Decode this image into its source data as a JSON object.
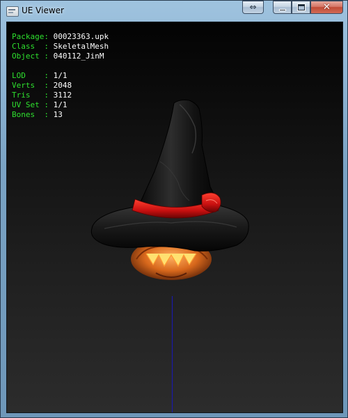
{
  "window": {
    "title": "UE Viewer"
  },
  "info": {
    "package": {
      "label": "Package: ",
      "value": "00023363.upk"
    },
    "class": {
      "label": "Class  : ",
      "value": "SkeletalMesh"
    },
    "object": {
      "label": "Object : ",
      "value": "040112_JinM"
    },
    "lod": {
      "label": "LOD    : ",
      "value": "1/1"
    },
    "verts": {
      "label": "Verts  : ",
      "value": "2048"
    },
    "tris": {
      "label": "Tris   : ",
      "value": "3112"
    },
    "uvset": {
      "label": "UV Set : ",
      "value": "1/1"
    },
    "bones": {
      "label": "Bones  : ",
      "value": "13"
    }
  },
  "colors": {
    "label_green": "#2ee02e",
    "value_white": "#ffffff",
    "hat_band_red": "#d81818",
    "pumpkin_orange": "#e07020",
    "axis_blue": "#1a1aa8"
  },
  "icons": {
    "app": "ue-viewer-app-icon",
    "extra": "swap-arrows-icon",
    "minimize": "minimize-icon",
    "maximize": "maximize-icon",
    "close": "close-icon"
  },
  "glyphs": {
    "extra": "⇔",
    "close": "✕"
  }
}
